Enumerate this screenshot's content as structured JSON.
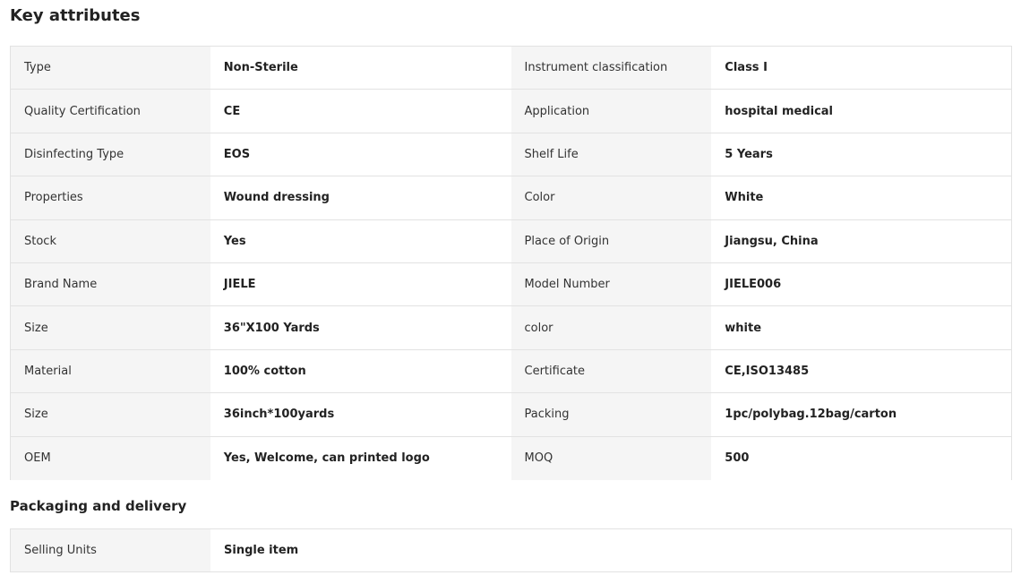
{
  "key_attributes": {
    "title": "Key attributes",
    "rows": [
      [
        {
          "label": "Type",
          "value": "Non-Sterile"
        },
        {
          "label": "Instrument classification",
          "value": "Class I"
        }
      ],
      [
        {
          "label": "Quality Certification",
          "value": "CE"
        },
        {
          "label": "Application",
          "value": "hospital medical"
        }
      ],
      [
        {
          "label": "Disinfecting Type",
          "value": "EOS"
        },
        {
          "label": "Shelf Life",
          "value": "5 Years"
        }
      ],
      [
        {
          "label": "Properties",
          "value": "Wound dressing"
        },
        {
          "label": "Color",
          "value": "White"
        }
      ],
      [
        {
          "label": "Stock",
          "value": "Yes"
        },
        {
          "label": "Place of Origin",
          "value": "Jiangsu, China"
        }
      ],
      [
        {
          "label": "Brand Name",
          "value": "JIELE"
        },
        {
          "label": "Model Number",
          "value": "JIELE006"
        }
      ],
      [
        {
          "label": "Size",
          "value": "36\"X100 Yards"
        },
        {
          "label": "color",
          "value": "white"
        }
      ],
      [
        {
          "label": "Material",
          "value": "100% cotton"
        },
        {
          "label": "Certificate",
          "value": "CE,ISO13485"
        }
      ],
      [
        {
          "label": "Size",
          "value": "36inch*100yards"
        },
        {
          "label": "Packing",
          "value": "1pc/polybag.12bag/carton"
        }
      ],
      [
        {
          "label": "OEM",
          "value": "Yes, Welcome, can printed logo"
        },
        {
          "label": "MOQ",
          "value": "500"
        }
      ]
    ]
  },
  "packaging": {
    "title": "Packaging and delivery",
    "rows": [
      {
        "label": "Selling Units",
        "value": "Single item"
      }
    ]
  }
}
